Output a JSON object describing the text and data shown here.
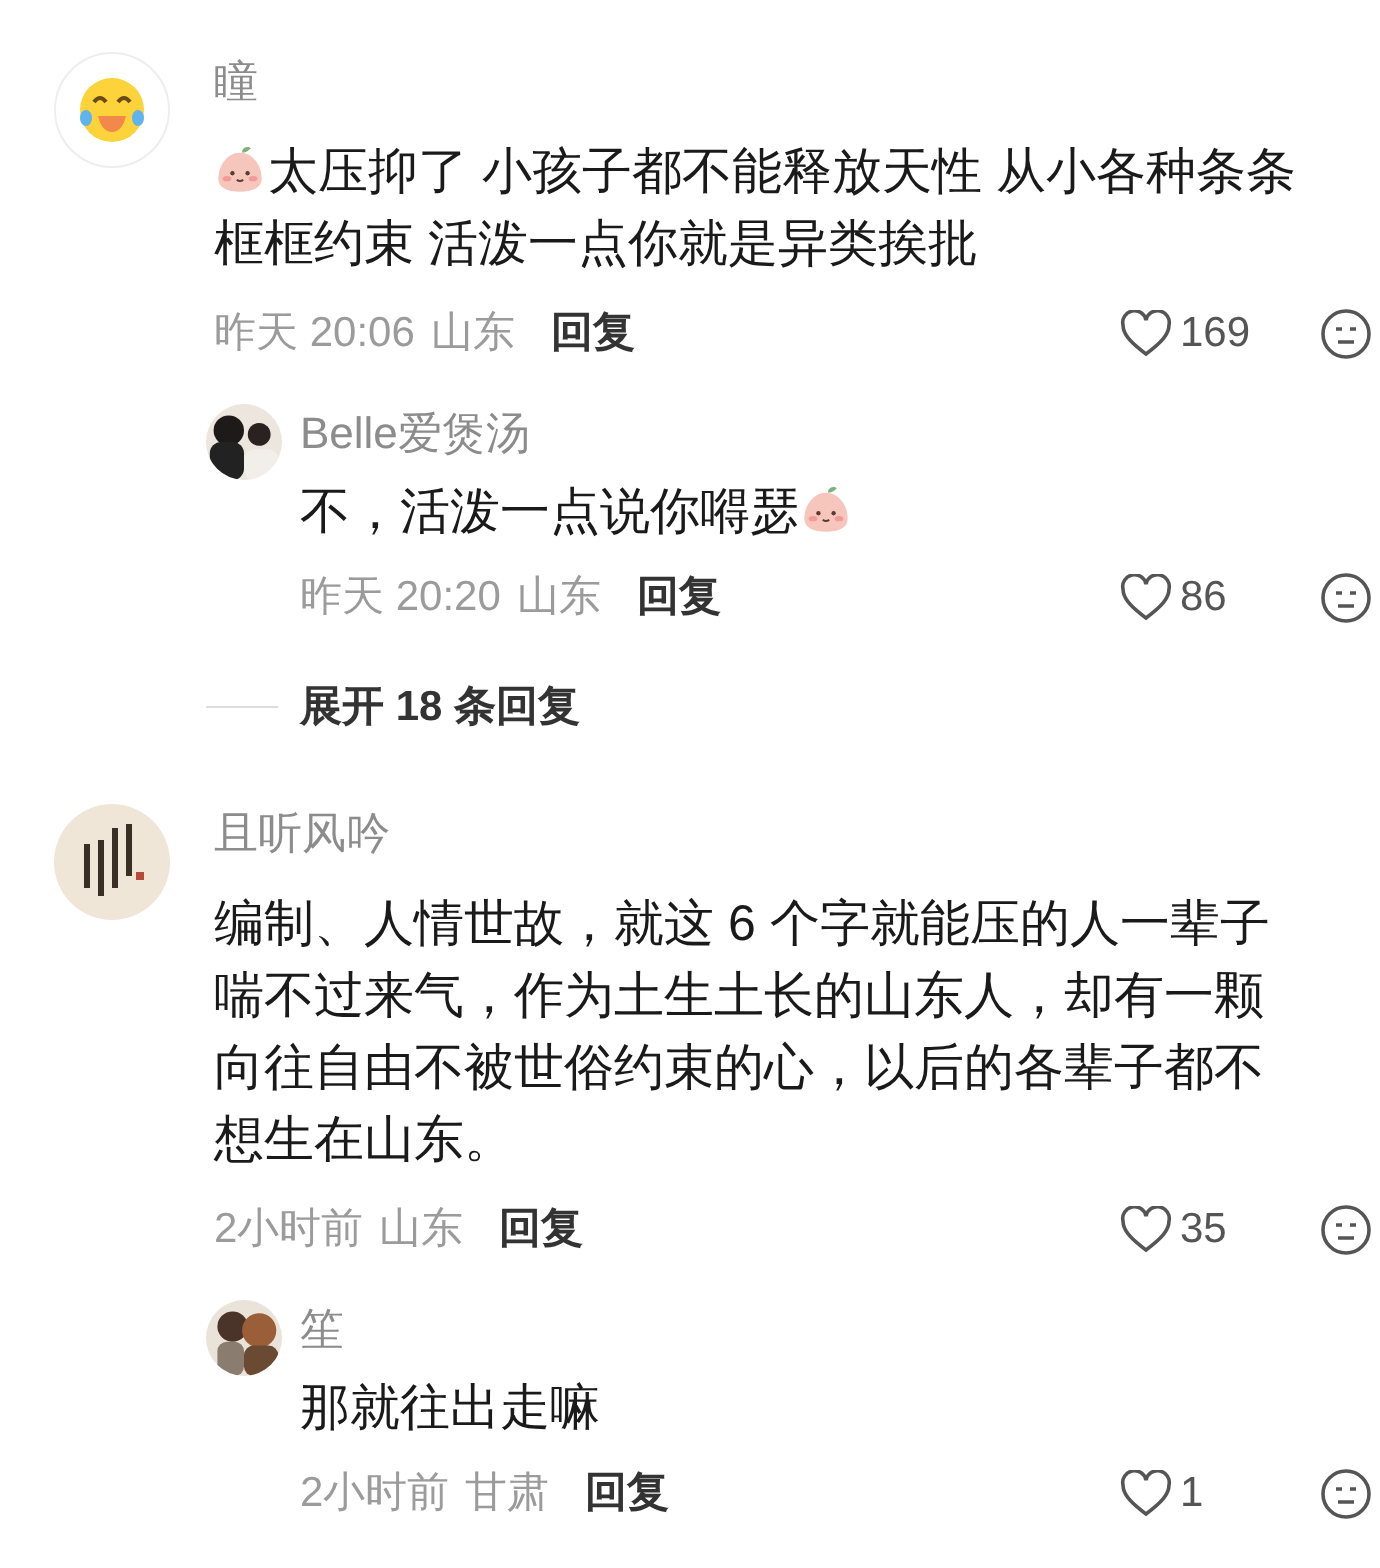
{
  "comments": [
    {
      "avatar": {
        "kind": "emoji"
      },
      "name": "瞳",
      "content": [
        {
          "kind": "emoji"
        },
        {
          "kind": "text",
          "text": "太压抑了 小孩子都不能释放天性 从小各种条条框框约束 活泼一点你就是异类挨批"
        }
      ],
      "time": "昨天 20:06",
      "location": "山东",
      "reply_label": "回复",
      "likes": "169",
      "replies": [
        {
          "avatar": {
            "kind": "picture"
          },
          "name": "Belle爱煲汤",
          "content": [
            {
              "kind": "text",
              "text": "不，活泼一点说你嘚瑟"
            },
            {
              "kind": "emoji"
            }
          ],
          "time": "昨天 20:20",
          "location": "山东",
          "reply_label": "回复",
          "likes": "86"
        }
      ],
      "expand": "展开 18 条回复"
    },
    {
      "avatar": {
        "kind": "picture"
      },
      "name": "且听风吟",
      "content": [
        {
          "kind": "text",
          "text": "编制、人情世故，就这 6 个字就能压的人一辈子喘不过来气，作为土生土长的山东人，却有一颗向往自由不被世俗约束的心，以后的各辈子都不想生在山东。"
        }
      ],
      "time": "2小时前",
      "location": "山东",
      "reply_label": "回复",
      "likes": "35",
      "replies": [
        {
          "avatar": {
            "kind": "picture"
          },
          "name": "笙",
          "content": [
            {
              "kind": "text",
              "text": "那就往出走嘛"
            }
          ],
          "time": "2小时前",
          "location": "甘肃",
          "reply_label": "回复",
          "likes": "1"
        }
      ]
    }
  ]
}
